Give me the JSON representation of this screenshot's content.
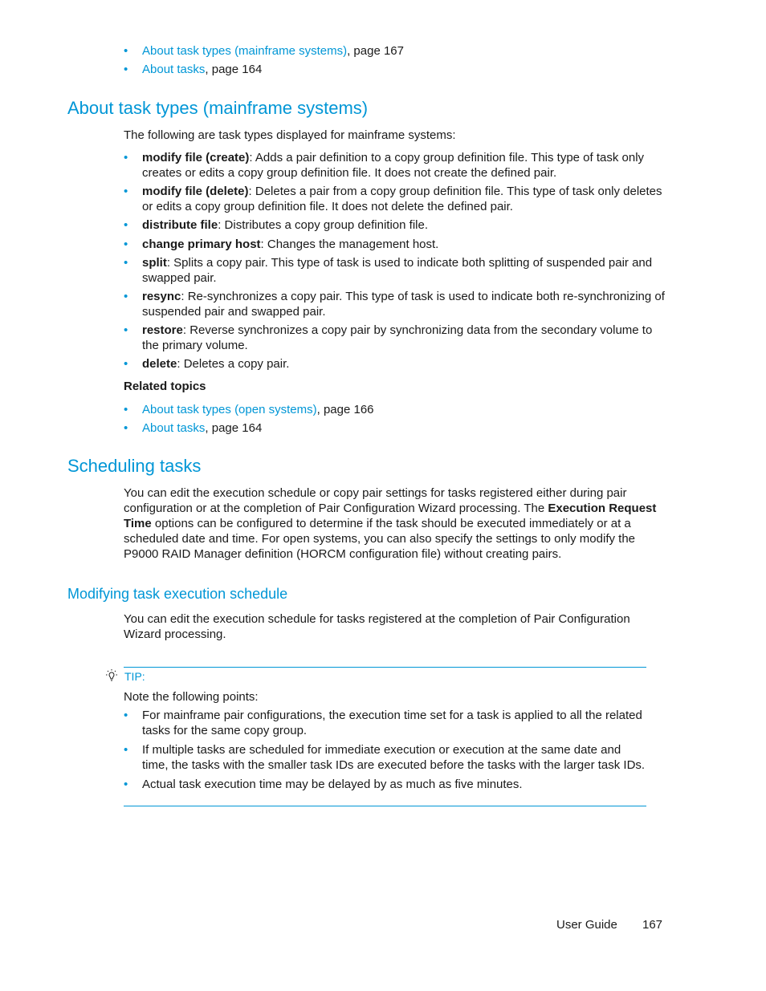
{
  "top_links": [
    {
      "link": "About task types (mainframe systems)",
      "suffix": ", page 167"
    },
    {
      "link": "About tasks",
      "suffix": ", page 164"
    }
  ],
  "section1": {
    "title": "About task types (mainframe systems)",
    "intro": "The following are task types displayed for mainframe systems:",
    "items": [
      {
        "term": "modify file (create)",
        "desc": ": Adds a pair definition to a copy group definition file. This type of task only creates or edits a copy group definition file. It does not create the defined pair."
      },
      {
        "term": "modify file (delete)",
        "desc": ": Deletes a pair from a copy group definition file. This type of task only deletes or edits a copy group definition file. It does not delete the defined pair."
      },
      {
        "term": "distribute file",
        "desc": ": Distributes a copy group definition file."
      },
      {
        "term": "change primary host",
        "desc": ": Changes the management host."
      },
      {
        "term": "split",
        "desc": ": Splits a copy pair. This type of task is used to indicate both splitting of suspended pair and swapped pair."
      },
      {
        "term": "resync",
        "desc": ": Re-synchronizes a copy pair. This type of task is used to indicate both re-synchronizing of suspended pair and swapped pair."
      },
      {
        "term": "restore",
        "desc": ": Reverse synchronizes a copy pair by synchronizing data from the secondary volume to the primary volume."
      },
      {
        "term": "delete",
        "desc": ": Deletes a copy pair."
      }
    ],
    "related_heading": "Related topics",
    "related": [
      {
        "link": "About task types (open systems)",
        "suffix": ", page 166"
      },
      {
        "link": "About tasks",
        "suffix": ", page 164"
      }
    ]
  },
  "section2": {
    "title": "Scheduling tasks",
    "para_a": "You can edit the execution schedule or copy pair settings for tasks registered either during pair configuration or at the completion of Pair Configuration Wizard processing. The ",
    "para_bold": "Execution Request Time",
    "para_b": " options can be configured to determine if the task should be executed immediately or at a scheduled date and time. For open systems, you can also specify the settings to only modify the P9000 RAID Manager definition (HORCM configuration file) without creating pairs."
  },
  "section3": {
    "title": "Modifying task execution schedule",
    "para": "You can edit the execution schedule for tasks registered at the completion of Pair Configuration Wizard processing.",
    "tip": {
      "label": "TIP:",
      "icon": "lightbulb-icon",
      "intro": "Note the following points:",
      "items": [
        "For mainframe pair configurations, the execution time set for a task is applied to all the related tasks for the same copy group.",
        "If multiple tasks are scheduled for immediate execution or execution at the same date and time, the tasks with the smaller task IDs are executed before the tasks with the larger task IDs.",
        "Actual task execution time may be delayed by as much as five minutes."
      ]
    }
  },
  "footer": {
    "guide": "User Guide",
    "page": "167"
  }
}
